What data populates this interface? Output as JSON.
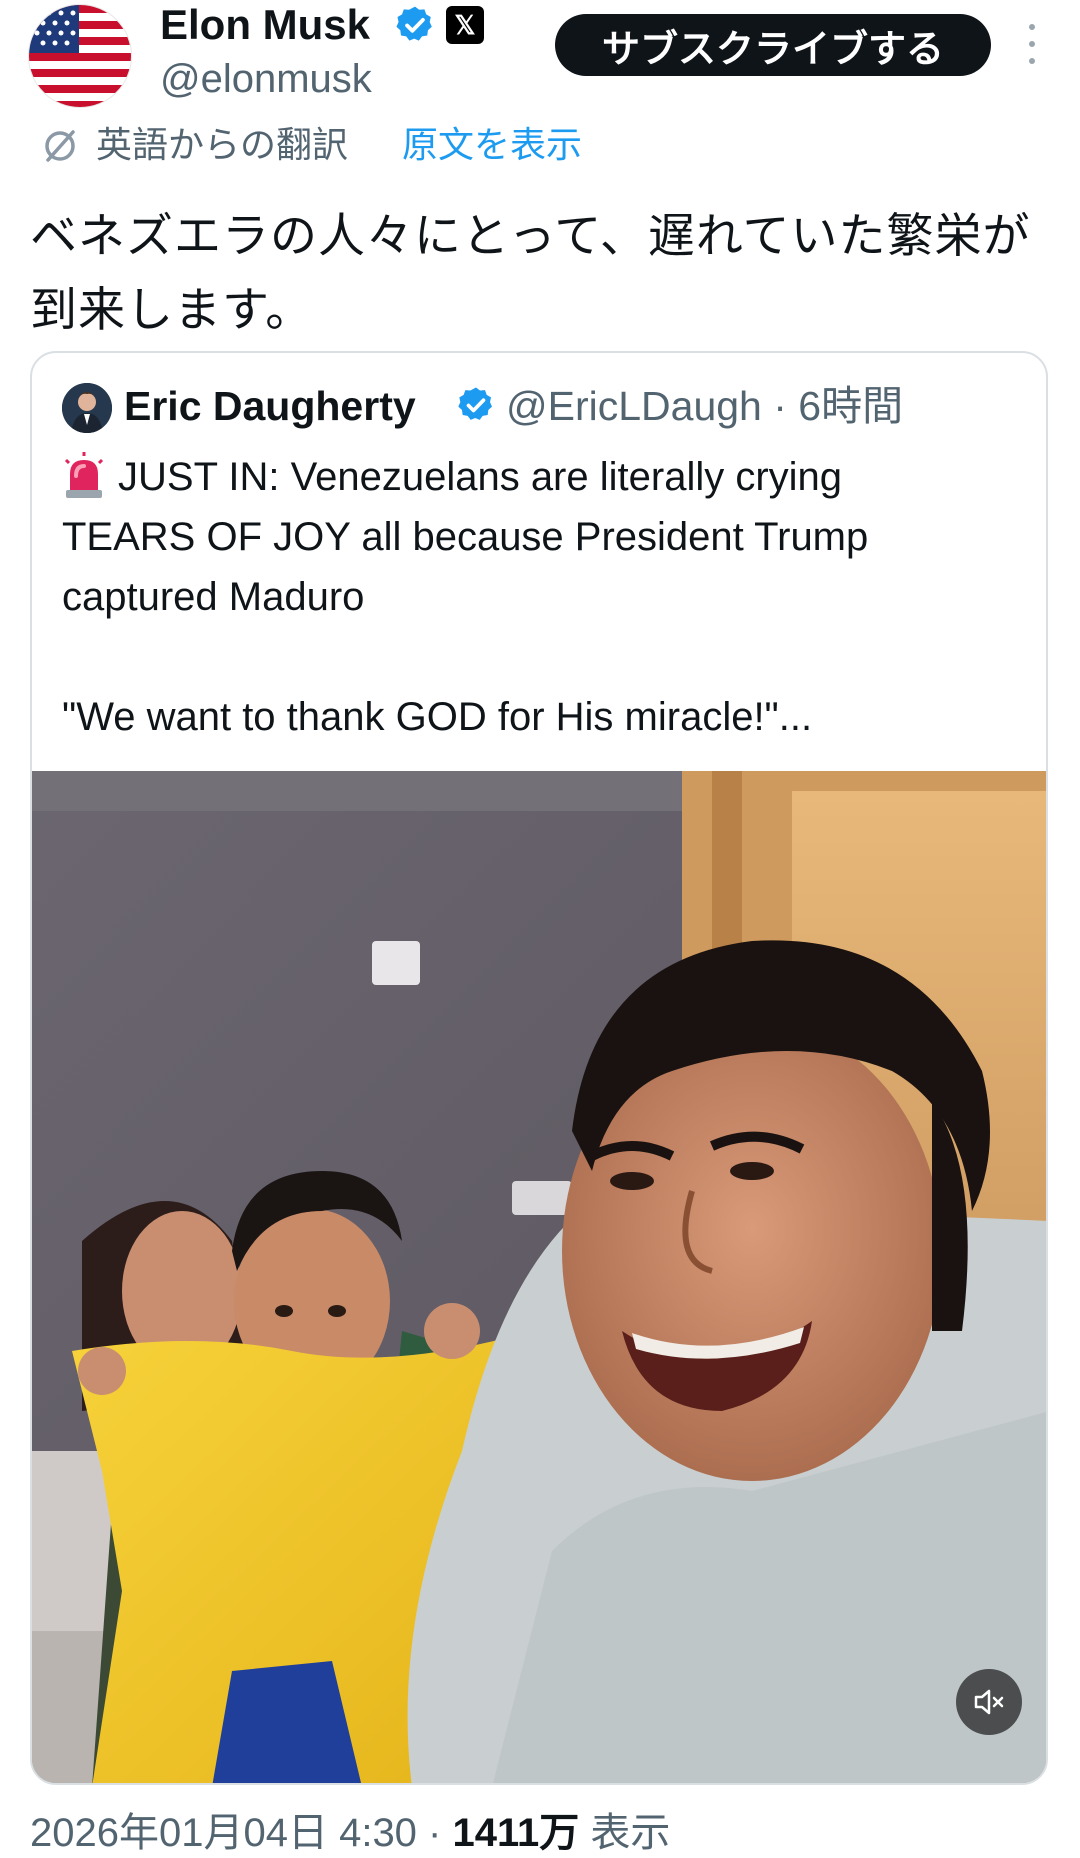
{
  "author": {
    "name": "Elon Musk",
    "handle": "@elonmusk",
    "x_badge": "𝕏"
  },
  "subscribe_label": "サブスクライブする",
  "translation": {
    "label": "英語からの翻訳",
    "show_original": "原文を表示"
  },
  "tweet_text": "ベネズエラの人々にとって、遅れていた繁栄が到来します。",
  "quote": {
    "name": "Eric Daugherty",
    "handle_time": "@EricLDaugh · 6時間",
    "text_lines": [
      "JUST IN: Venezuelans are literally crying",
      "TEARS OF JOY all because President Trump",
      "captured Maduro",
      "\"We want to thank GOD for His miracle!\"..."
    ]
  },
  "meta": {
    "date_time": "2026年01月04日 4:30 · ",
    "views_count": "1411万",
    "views_label": " 表示"
  },
  "colors": {
    "accent": "#1d9bf0",
    "secondary_text": "#536471",
    "primary_text": "#0f1419"
  },
  "icons": [
    "verified-badge-icon",
    "x-logo-icon",
    "more-options-icon",
    "translate-icon",
    "siren-emoji-icon",
    "mute-icon"
  ]
}
